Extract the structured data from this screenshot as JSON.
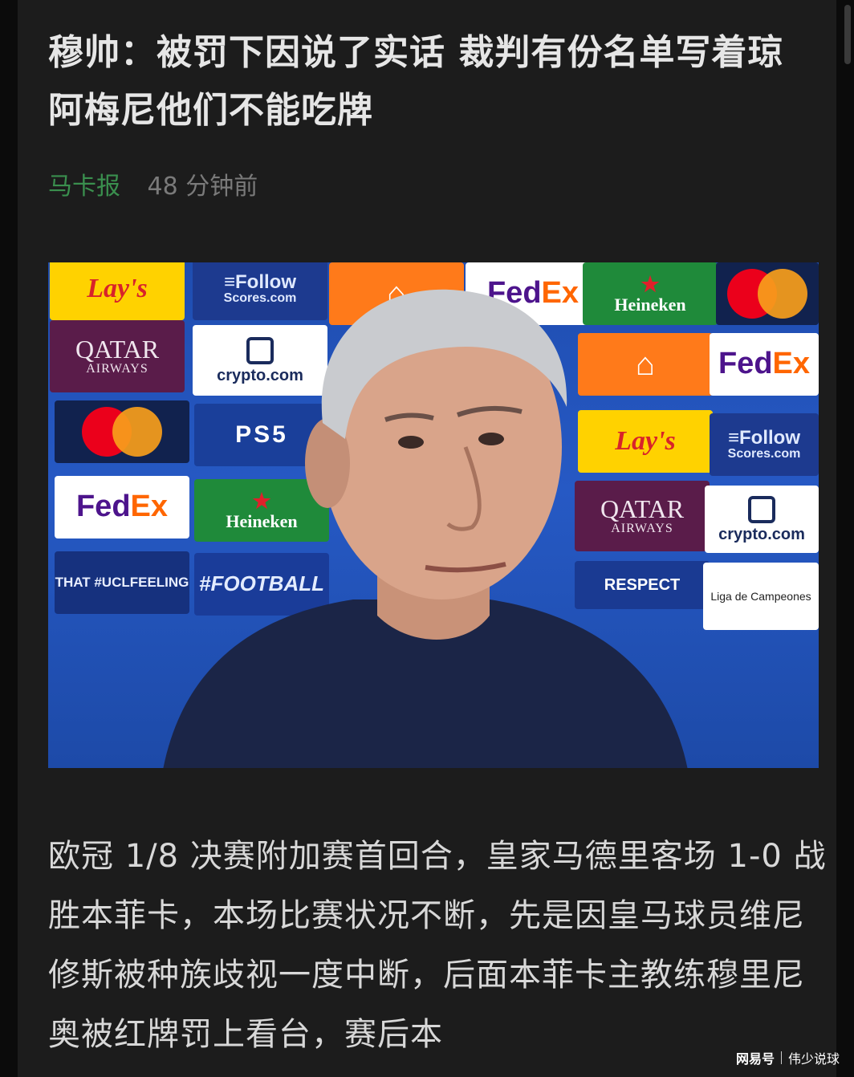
{
  "article": {
    "title": "穆帅：被罚下因说了实话 裁判有份名单写着琼阿梅尼他们不能吃牌",
    "source": "马卡报",
    "time": "48 分钟前",
    "body": "欧冠 1/8 决赛附加赛首回合，皇家马德里客场 1-0 战胜本菲卡，本场比赛状况不断，先是因皇马球员维尼修斯被种族歧视一度中断，后面本菲卡主教练穆里尼奥被红牌罚上看台，赛后本"
  },
  "photo": {
    "logos": {
      "lays": "Lay's",
      "follow": "≡Follow",
      "follow_sub": "Scores.com",
      "qatar": "QATAR",
      "qatar_sub": "AIRWAYS",
      "crypto": "crypto.com",
      "ps5": "PS5",
      "fedex_a": "Fed",
      "fedex_b": "Ex",
      "heineken": "Heineken",
      "mcl": "THAT #UCLFEELING",
      "foot": "#FOOTBALL",
      "respect": "RESPECT",
      "liga": "Liga de Campeones"
    }
  },
  "watermark": {
    "brand": "网易号",
    "author": "伟少说球"
  }
}
